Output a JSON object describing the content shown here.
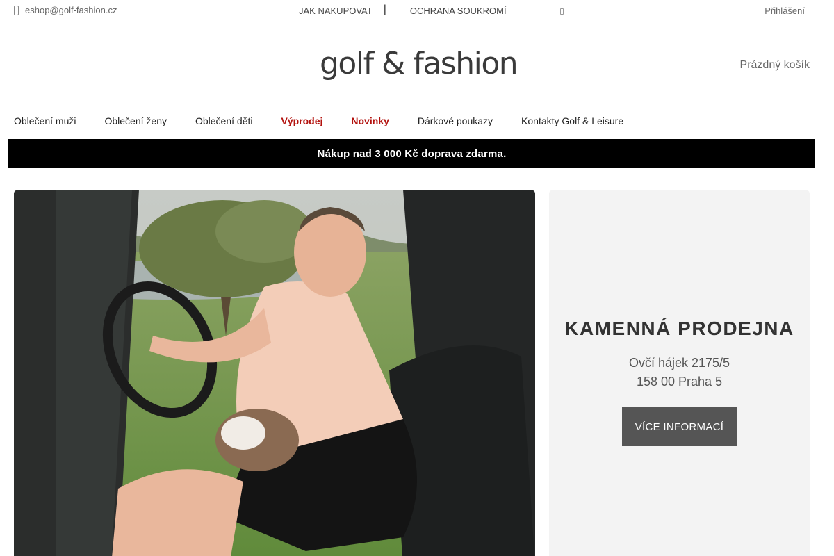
{
  "topbar": {
    "email": "eshop@golf-fashion.cz",
    "links": [
      "JAK NAKUPOVAT",
      "OCHRANA SOUKROMÍ"
    ],
    "separator": "|",
    "login": "Přihlášení"
  },
  "header": {
    "logo": "golf & fashion",
    "cart": "Prázdný košík"
  },
  "nav": {
    "items": [
      {
        "label": "Oblečení muži",
        "highlight": false
      },
      {
        "label": "Oblečení ženy",
        "highlight": false
      },
      {
        "label": "Oblečení děti",
        "highlight": false
      },
      {
        "label": "Výprodej",
        "highlight": true
      },
      {
        "label": "Novinky",
        "highlight": true
      },
      {
        "label": "Dárkové poukazy",
        "highlight": false
      },
      {
        "label": "Kontakty Golf & Leisure",
        "highlight": false
      }
    ],
    "highlight_color": "#b3120e"
  },
  "banner": {
    "text": "Nákup nad 3 000 Kč doprava zdarma."
  },
  "store": {
    "title": "KAMENNÁ PRODEJNA",
    "address_line1": "Ovčí hájek 2175/5",
    "address_line2": "158 00 Praha 5",
    "button": "VÍCE INFORMACÍ"
  },
  "icons": {
    "email": "phone-icon",
    "topbar_small": "phone-icon"
  }
}
